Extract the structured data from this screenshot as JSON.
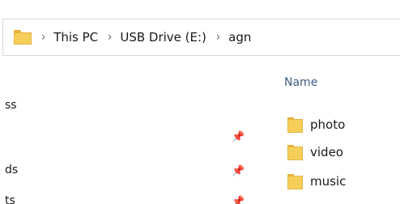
{
  "address_bar": {
    "crumbs": [
      "This PC",
      "USB Drive (E:)",
      "agn"
    ],
    "separator": "›"
  },
  "nav_pane": {
    "items": [
      {
        "label": "ss",
        "pinned": false
      },
      {
        "label": "",
        "pinned": true
      },
      {
        "label": "ds",
        "pinned": true
      },
      {
        "label": "ts",
        "pinned": true
      }
    ]
  },
  "content": {
    "column_header": "Name",
    "folders": [
      "photo",
      "video",
      "music"
    ]
  },
  "colors": {
    "folder_fill": "#f6cf5b",
    "folder_border": "#e5b540",
    "header_text": "#3d5a80"
  },
  "icons": {
    "folder": "folder-icon",
    "pin": "pin-icon"
  }
}
